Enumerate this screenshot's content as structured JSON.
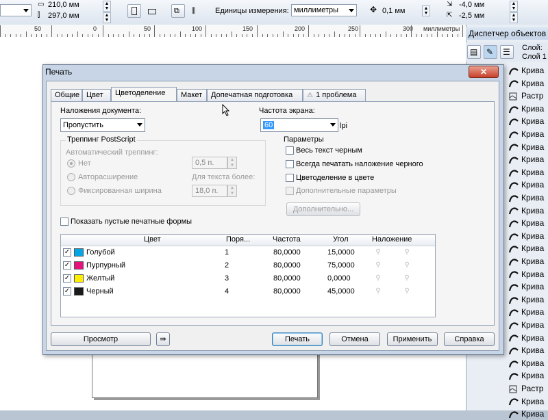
{
  "toolbar": {
    "width_value": "210,0 мм",
    "height_value": "297,0 мм",
    "units_label": "Единицы измерения:",
    "units_value": "миллиметры",
    "nudge_value": "0,1 мм",
    "x_value": "-4,0 мм",
    "y_value": "-2,5 мм"
  },
  "ruler": {
    "labels": [
      "50",
      "0",
      "50",
      "100",
      "150",
      "200",
      "250",
      "300"
    ],
    "unit": "миллиметры"
  },
  "docker": {
    "title": "Диспетчер объектов",
    "layer_label": "Слой:",
    "layer_name": "Слой 1",
    "items": [
      "Крива",
      "Крива",
      "Растр",
      "Крива",
      "Крива",
      "Крива",
      "Крива",
      "Крива",
      "Крива",
      "Крива",
      "Крива",
      "Крива",
      "Крива",
      "Крива",
      "Крива",
      "Крива",
      "Крива",
      "Крива",
      "Крива",
      "Крива",
      "Крива",
      "Крива",
      "Крива",
      "Крива",
      "Крива",
      "Растр",
      "Крива",
      "Крива"
    ]
  },
  "dialog": {
    "title": "Печать",
    "close_label": "✕",
    "tabs": [
      "Общие",
      "Цвет",
      "Цветоделение",
      "Макет",
      "Допечатная подготовка",
      "1 проблема"
    ],
    "doc_overprint_label": "Наложения документа:",
    "doc_overprint_value": "Пропустить",
    "screen_freq_label": "Частота экрана:",
    "screen_freq_value": "60",
    "screen_freq_unit": "lpi",
    "trapping_group": "Треппинг PostScript",
    "auto_trapping_label": "Автоматический треппинг:",
    "radio_none": "Нет",
    "radio_auto_spread": "Авторасширение",
    "radio_fixed_width": "Фиксированная ширина",
    "trap_width_value": "0,5 п.",
    "text_above_label": "Для текста более:",
    "text_above_value": "18,0 п.",
    "params_group": "Параметры",
    "cb_all_text_black": "Весь текст черным",
    "cb_always_overprint_black": "Всегда печатать наложение черного",
    "cb_color_separation": "Цветоделение в цвете",
    "cb_extra_params": "Дополнительные параметры",
    "advanced_button": "Дополнительно...",
    "cb_show_empty_plates": "Показать пустые печатные формы",
    "table": {
      "headers": [
        "Цвет",
        "Поря...",
        "Частота",
        "Угол",
        "Наложение"
      ],
      "rows": [
        {
          "name": "Голубой",
          "order": "1",
          "freq": "80,0000",
          "angle": "15,0000",
          "color": "#00a6e6"
        },
        {
          "name": "Пурпурный",
          "order": "2",
          "freq": "80,0000",
          "angle": "75,0000",
          "color": "#e8107e"
        },
        {
          "name": "Желтый",
          "order": "3",
          "freq": "80,0000",
          "angle": "0,0000",
          "color": "#ffee00"
        },
        {
          "name": "Черный",
          "order": "4",
          "freq": "80,0000",
          "angle": "45,0000",
          "color": "#1a1a1a"
        }
      ]
    },
    "buttons": {
      "preview": "Просмотр",
      "print": "Печать",
      "cancel": "Отмена",
      "apply": "Применить",
      "help": "Справка"
    }
  }
}
